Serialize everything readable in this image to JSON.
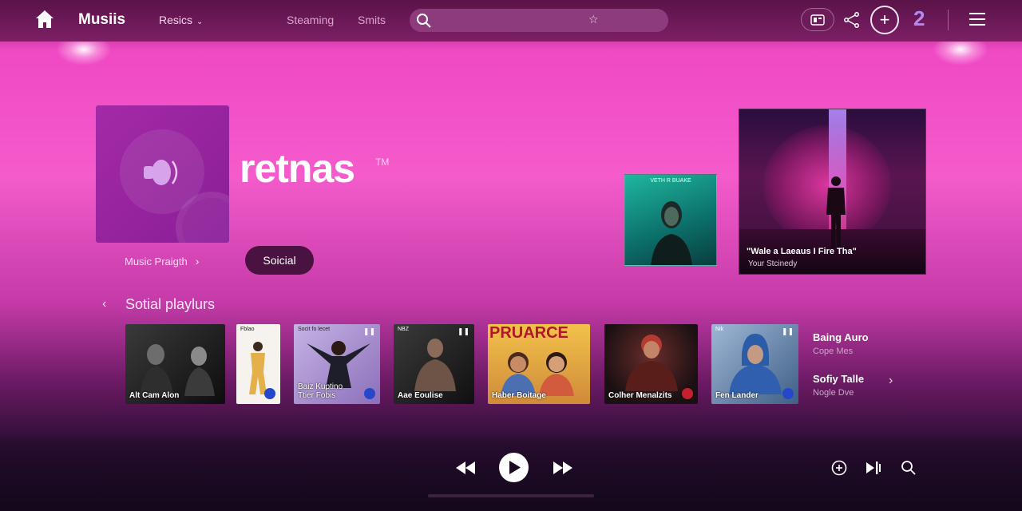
{
  "colors": {
    "accent": "#f45bcb",
    "topbar": "#7d1f66",
    "count": "#b389f0"
  },
  "topbar": {
    "brand": "Musiis",
    "dropdown_label": "Resics",
    "nav_links": [
      "Steaming",
      "Smits"
    ],
    "search_placeholder": "",
    "search_icon": "search-icon",
    "count": "2"
  },
  "hero": {
    "title": "retnas",
    "trademark": "TM",
    "link_label": "Music Praigth",
    "button_label": "Soicial"
  },
  "featured": {
    "small_caption": "VETH R BUAKE",
    "big_title": "\"Wale a Laeaus I Fire Tha\"",
    "big_subtitle": "Your Stcinedy"
  },
  "playlists": {
    "heading": "Sotial playlurs",
    "cards": [
      {
        "caption": "Alt Cam Alon",
        "top": "",
        "color": "#1c1c1c"
      },
      {
        "caption": "",
        "top": "Fblao",
        "color": "#ffffff"
      },
      {
        "caption": "Ttier Fobis",
        "caption2": "Baiz Kuptino",
        "top": "Socit fo lecet",
        "color": "#9d84c8"
      },
      {
        "caption": "Aae Eoulise",
        "top": "NBZ",
        "color": "#202020"
      },
      {
        "caption": "Haber Boitage",
        "top": "PRUARCE",
        "color": "#e7b03a"
      },
      {
        "caption": "Colher Menalzits",
        "top": "",
        "color": "#3a1d22"
      },
      {
        "caption": "Fen Lander",
        "top": "Nik",
        "color": "#5f7fa6"
      }
    ],
    "side": [
      {
        "title": "Baing Auro",
        "subtitle": "Cope Mes"
      },
      {
        "title": "Sofiy Talle",
        "subtitle": "Nogle Dve"
      }
    ]
  },
  "player": {
    "progress": 0.0
  }
}
